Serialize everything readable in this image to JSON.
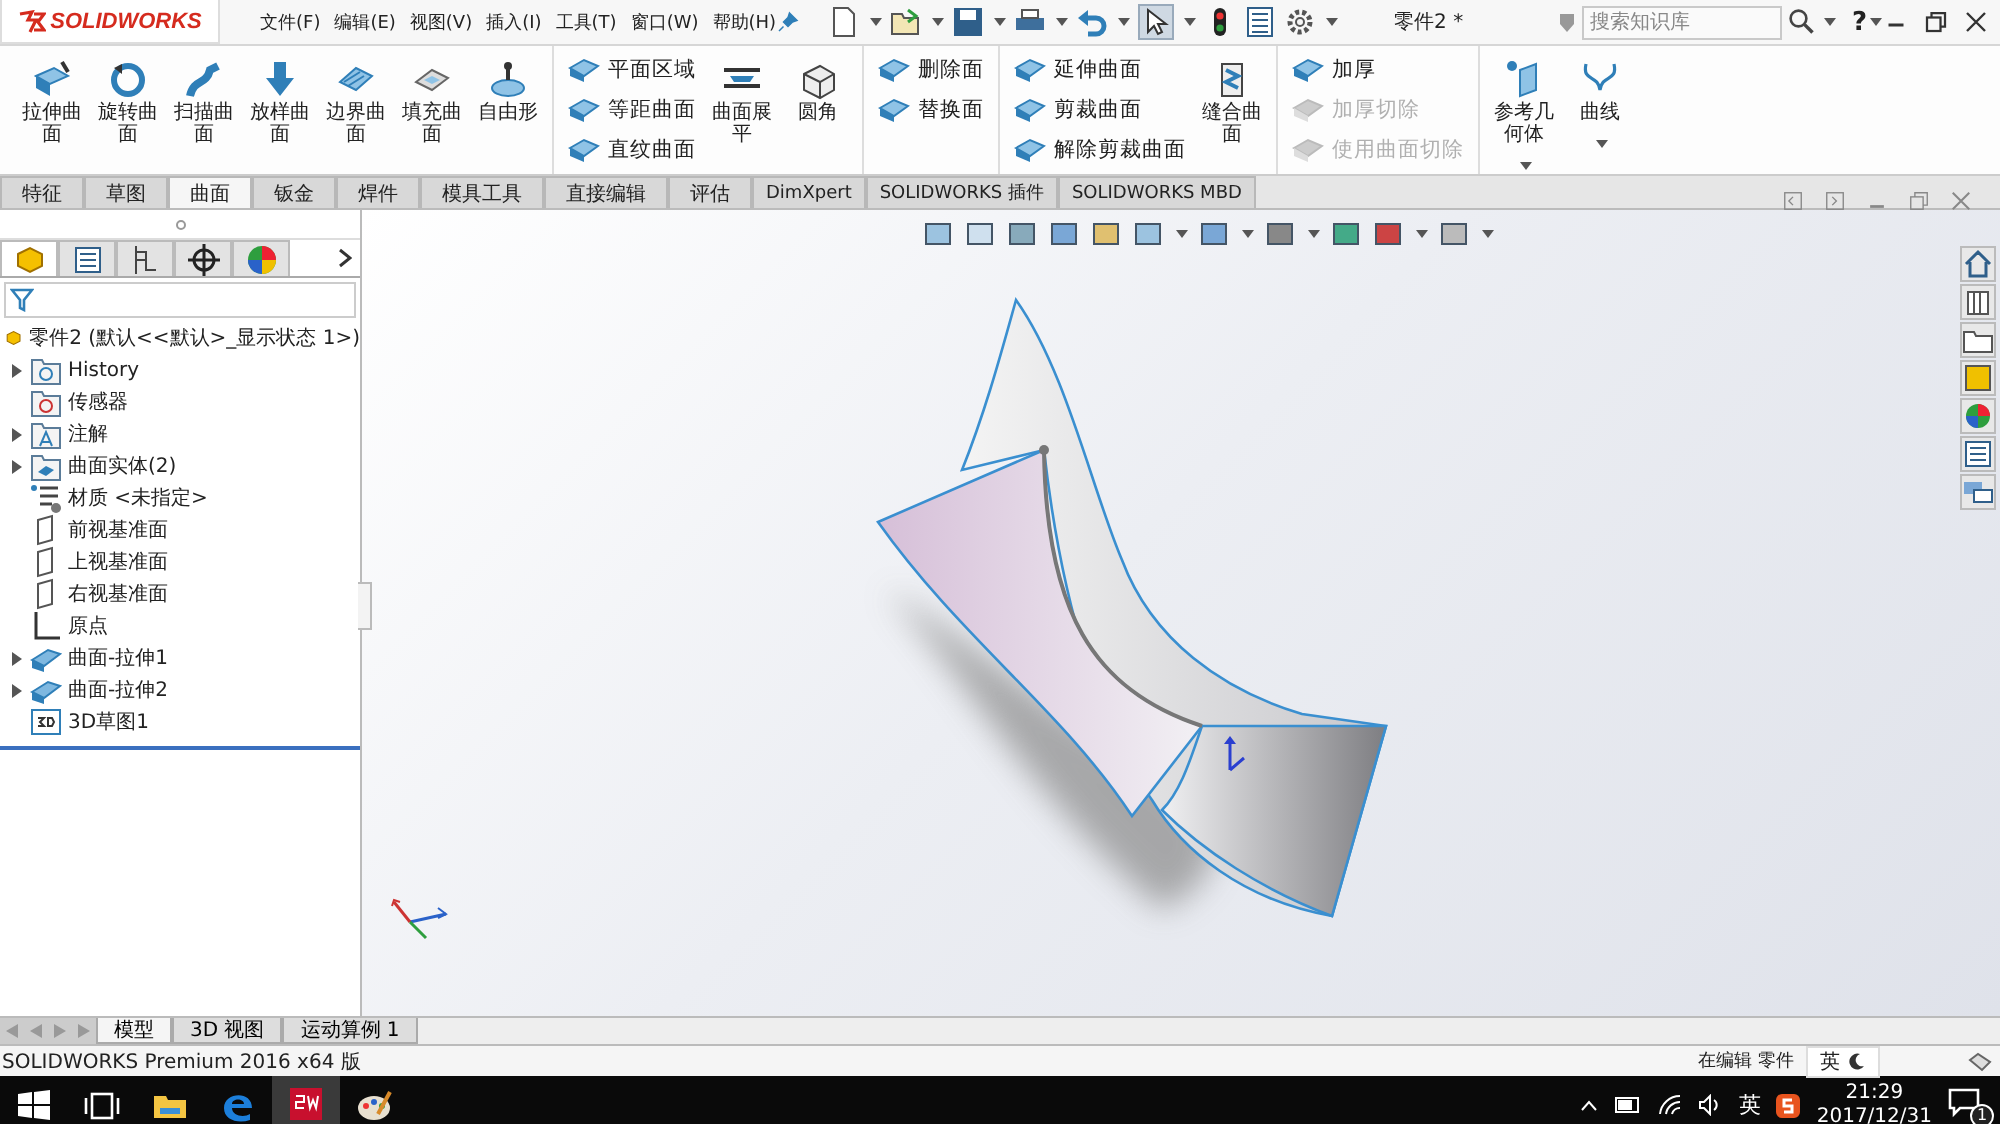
{
  "app": {
    "logo": "SOLIDWORKS",
    "menu": [
      "文件(F)",
      "编辑(E)",
      "视图(V)",
      "插入(I)",
      "工具(T)",
      "窗口(W)",
      "帮助(H)"
    ],
    "document_title": "零件2 *",
    "search": {
      "placeholder": "搜索知识库"
    },
    "help_label": "?"
  },
  "ribbon": {
    "groups": [
      {
        "columns": [
          {
            "kind": "large",
            "label": "拉伸曲面"
          },
          {
            "kind": "large",
            "label": "旋转曲面"
          },
          {
            "kind": "large",
            "label": "扫描曲面"
          },
          {
            "kind": "large",
            "label": "放样曲面"
          },
          {
            "kind": "large",
            "label": "边界曲面"
          },
          {
            "kind": "large",
            "label": "填充曲面"
          },
          {
            "kind": "large",
            "label": "自由形"
          }
        ]
      },
      {
        "columns": [
          {
            "kind": "stack",
            "items": [
              {
                "label": "平面区域",
                "disabled": false
              },
              {
                "label": "等距曲面",
                "disabled": false
              },
              {
                "label": "直纹曲面",
                "disabled": false
              }
            ]
          },
          {
            "kind": "large",
            "label": "曲面展平"
          },
          {
            "kind": "large",
            "label": "圆角"
          }
        ]
      },
      {
        "columns": [
          {
            "kind": "stack",
            "items": [
              {
                "label": "删除面",
                "disabled": false
              },
              {
                "label": "替换面",
                "disabled": false
              }
            ]
          }
        ]
      },
      {
        "columns": [
          {
            "kind": "stack",
            "items": [
              {
                "label": "延伸曲面",
                "disabled": false
              },
              {
                "label": "剪裁曲面",
                "disabled": false
              },
              {
                "label": "解除剪裁曲面",
                "disabled": false
              }
            ]
          },
          {
            "kind": "large",
            "label": "缝合曲面"
          }
        ]
      },
      {
        "columns": [
          {
            "kind": "stack",
            "items": [
              {
                "label": "加厚",
                "disabled": false
              },
              {
                "label": "加厚切除",
                "disabled": true
              },
              {
                "label": "使用曲面切除",
                "disabled": true
              }
            ]
          }
        ]
      },
      {
        "columns": [
          {
            "kind": "large",
            "label": "参考几何体",
            "dropdown": true
          },
          {
            "kind": "large",
            "label": "曲线",
            "dropdown": true
          }
        ]
      }
    ]
  },
  "tabs": [
    {
      "label": "特征",
      "selected": false
    },
    {
      "label": "草图",
      "selected": false
    },
    {
      "label": "曲面",
      "selected": true
    },
    {
      "label": "钣金",
      "selected": false
    },
    {
      "label": "焊件",
      "selected": false
    },
    {
      "label": "模具工具",
      "selected": false
    },
    {
      "label": "直接编辑",
      "selected": false
    },
    {
      "label": "评估",
      "selected": false
    },
    {
      "label": "DimXpert",
      "selected": false
    },
    {
      "label": "SOLIDWORKS 插件",
      "selected": false
    },
    {
      "label": "SOLIDWORKS MBD",
      "selected": false
    }
  ],
  "panel_tabs": [
    {
      "kind": "feature-manager",
      "selected": true
    },
    {
      "kind": "property-manager",
      "selected": false
    },
    {
      "kind": "configuration-manager",
      "selected": false
    },
    {
      "kind": "dimxpert-manager",
      "selected": false
    },
    {
      "kind": "display-manager",
      "selected": false
    }
  ],
  "feature_tree": {
    "root": "零件2  (默认<<默认>_显示状态 1>)",
    "items": [
      {
        "label": "History",
        "kind": "history",
        "expandable": true
      },
      {
        "label": "传感器",
        "kind": "sensor",
        "expandable": false
      },
      {
        "label": "注解",
        "kind": "annotation",
        "expandable": true
      },
      {
        "label": "曲面实体(2)",
        "kind": "bodies",
        "expandable": true
      },
      {
        "label": "材质 <未指定>",
        "kind": "material",
        "expandable": false
      },
      {
        "label": "前视基准面",
        "kind": "plane",
        "expandable": false
      },
      {
        "label": "上视基准面",
        "kind": "plane",
        "expandable": false
      },
      {
        "label": "右视基准面",
        "kind": "plane",
        "expandable": false
      },
      {
        "label": "原点",
        "kind": "origin",
        "expandable": false
      },
      {
        "label": "曲面-拉伸1",
        "kind": "surface",
        "expandable": true
      },
      {
        "label": "曲面-拉伸2",
        "kind": "surface",
        "expandable": true
      },
      {
        "label": "3D草图1",
        "kind": "sketch3d",
        "expandable": false
      }
    ]
  },
  "bottom_tabs": [
    {
      "label": "模型",
      "selected": true
    },
    {
      "label": "3D 视图",
      "selected": false
    },
    {
      "label": "运动算例 1",
      "selected": false
    }
  ],
  "status_bar": {
    "product": "SOLIDWORKS Premium 2016 x64 版",
    "mode": "在编辑 零件",
    "ime": "英"
  },
  "taskbar": {
    "apps": [
      {
        "kind": "start",
        "active": false
      },
      {
        "kind": "task-view",
        "active": false
      },
      {
        "kind": "explorer",
        "active": false
      },
      {
        "kind": "edge",
        "active": false
      },
      {
        "kind": "solidworks",
        "active": true
      },
      {
        "kind": "paint",
        "active": false
      }
    ],
    "ime": "英",
    "time": "21:29",
    "date": "2017/12/31",
    "notifications": "1"
  }
}
